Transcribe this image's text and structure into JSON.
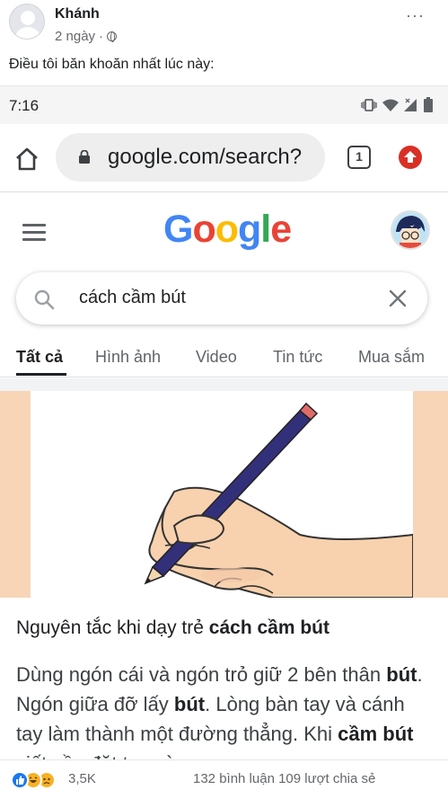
{
  "post": {
    "author": "Khánh",
    "time": "2 ngày",
    "separator": "·",
    "caption": "Điều tôi băn khoăn nhất lúc này:",
    "more": "···"
  },
  "phone": {
    "time": "7:16",
    "url": "google.com/search?",
    "tab_count": "1"
  },
  "google": {
    "logo_letters": [
      {
        "char": "G",
        "color": "#4285F4"
      },
      {
        "char": "o",
        "color": "#EA4335"
      },
      {
        "char": "o",
        "color": "#FBBC05"
      },
      {
        "char": "g",
        "color": "#4285F4"
      },
      {
        "char": "l",
        "color": "#34A853"
      },
      {
        "char": "e",
        "color": "#EA4335"
      }
    ],
    "query": "cách cầm bút",
    "tabs": [
      "Tất cả",
      "Hình ảnh",
      "Video",
      "Tin tức",
      "Mua sắm"
    ],
    "result": {
      "title_prefix": "Nguyên tắc khi dạy trẻ ",
      "title_bold": "cách cầm bút",
      "body": [
        {
          "text": "Dùng ngón cái và ngón trỏ giữ 2 bên thân ",
          "bold": false
        },
        {
          "text": "bút",
          "bold": true
        },
        {
          "text": ". Ngón giữa đỡ lấy ",
          "bold": false
        },
        {
          "text": "bút",
          "bold": true
        },
        {
          "text": ". Lòng bàn tay và cánh tay làm thành một đường thẳng. ",
          "bold": false
        },
        {
          "text": "Khi ",
          "bold": false
        },
        {
          "text": "cầm bút",
          "bold": true
        },
        {
          "text": " viết cần đặt tay vào",
          "bold": false
        }
      ]
    }
  },
  "footer": {
    "reaction_count": "3,5K",
    "comments": "132 bình luận",
    "shares": "109 lượt chia sẻ"
  },
  "colors": {
    "like_blue": "#1877F2",
    "haha_yellow": "#F7B125",
    "google_red": "#d93025"
  }
}
